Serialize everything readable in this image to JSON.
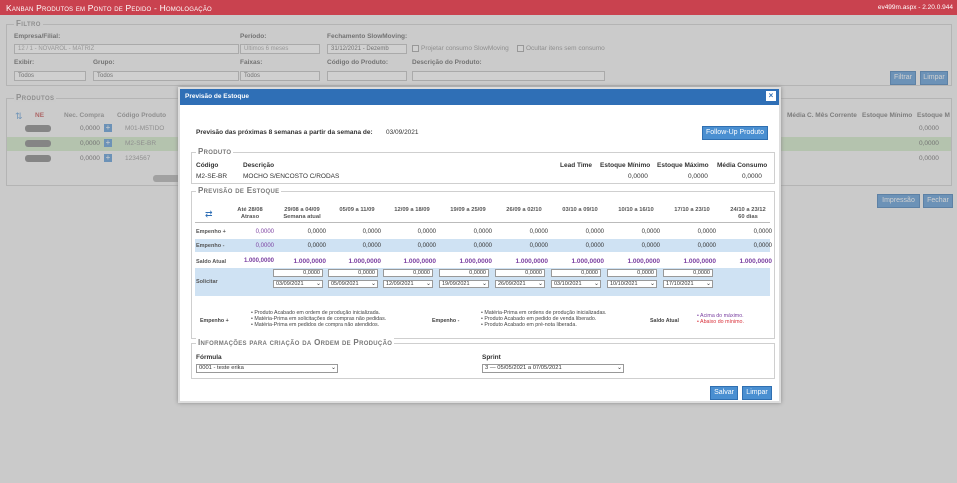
{
  "app": {
    "title": "Kanban Produtos em Ponto de Pedido - Homologação",
    "version": "ev499m.aspx - 2.20.0.944"
  },
  "filter": {
    "legend": "Filtro",
    "empresa_label": "Empresa/Filial:",
    "empresa_value": "12 / 1 - NOVAROL - MATRIZ",
    "periodo_label": "Período:",
    "periodo_value": "Últimos 6 meses",
    "fechamento_label": "Fechamento SlowMoving:",
    "fechamento_value": "31/12/2021 - Dezemb",
    "projetar_label": "Projetar consumo SlowMoving",
    "ocultar_label": "Ocultar itens sem consumo",
    "exibir_label": "Exibir:",
    "exibir_value": "Todos",
    "grupo_label": "Grupo:",
    "grupo_value": "Todos",
    "faixas_label": "Faixas:",
    "faixas_value": "Todos",
    "codigo_label": "Código do Produto:",
    "descricao_label": "Descrição do Produto:",
    "filtrar": "Filtrar",
    "limpar": "Limpar"
  },
  "produtos": {
    "legend": "Produtos",
    "col_ne": "NE",
    "col_nec": "Nec. Compra",
    "col_codigo": "Código Produto",
    "right_cols": [
      "Média",
      "C. Mês Corrente",
      "Estoque Mínimo",
      "Estoque M"
    ],
    "rows": [
      {
        "nec": "0,0000",
        "codigo": "M01-M5TIDO",
        "rval": "0,0000"
      },
      {
        "nec": "0,0000",
        "codigo": "M2-SE-BR",
        "rval": "0,0000"
      },
      {
        "nec": "0,0000",
        "codigo": "1234567",
        "rval": "0,0000"
      }
    ],
    "impressao": "Impressão",
    "fechar": "Fechar"
  },
  "modal": {
    "title": "Previsão de Estoque",
    "close": "×",
    "forecast_label": "Previsão das próximas 8 semanas a partir da semana de:",
    "forecast_date": "03/09/2021",
    "followup": "Follow-Up Produto",
    "produto": {
      "legend": "Produto",
      "h_codigo": "Código",
      "h_descricao": "Descrição",
      "h_lead": "Lead Time",
      "h_min": "Estoque Mínimo",
      "h_max": "Estoque Máximo",
      "h_media": "Média Consumo",
      "codigo": "M2-SE-BR",
      "descricao": "MOCHO S/ENCOSTO C/RODAS",
      "min": "0,0000",
      "max": "0,0000",
      "media": "0,0000"
    },
    "previsao": {
      "legend": "Previsão de Estoque",
      "cols": [
        {
          "l1": "Até 28/08",
          "l2": "Atraso"
        },
        {
          "l1": "29/08 a 04/09",
          "l2": "Semana atual"
        },
        {
          "l1": "05/09 a 11/09",
          "l2": ""
        },
        {
          "l1": "12/09 a 18/09",
          "l2": ""
        },
        {
          "l1": "19/09 a 25/09",
          "l2": ""
        },
        {
          "l1": "26/09 a 02/10",
          "l2": ""
        },
        {
          "l1": "03/10 a 09/10",
          "l2": ""
        },
        {
          "l1": "10/10 a 16/10",
          "l2": ""
        },
        {
          "l1": "17/10 a 23/10",
          "l2": ""
        },
        {
          "l1": "24/10 a 23/12",
          "l2": "60 dias"
        }
      ],
      "row_empenho_plus": "Empenho +",
      "row_empenho_minus": "Empenho -",
      "row_saldo": "Saldo Atual",
      "row_solicitar": "Solicitar",
      "empenho_plus": [
        "0,0000",
        "0,0000",
        "0,0000",
        "0,0000",
        "0,0000",
        "0,0000",
        "0,0000",
        "0,0000",
        "0,0000",
        "0,0000"
      ],
      "empenho_minus": [
        "0,0000",
        "0,0000",
        "0,0000",
        "0,0000",
        "0,0000",
        "0,0000",
        "0,0000",
        "0,0000",
        "0,0000",
        "0,0000"
      ],
      "saldo_first": "1.000,0000",
      "saldo": [
        "1.000,0000",
        "1.000,0000",
        "1.000,0000",
        "1.000,0000",
        "1.000,0000",
        "1.000,0000",
        "1.000,0000",
        "1.000,0000",
        "1.000,0000"
      ],
      "solicitar_qty": [
        "0,0000",
        "0,0000",
        "0,0000",
        "0,0000",
        "0,0000",
        "0,0000",
        "0,0000",
        "0,0000"
      ],
      "solicitar_dates": [
        "03/09/2021",
        "05/09/2021",
        "12/09/2021",
        "19/09/2021",
        "26/09/2021",
        "03/10/2021",
        "10/10/2021",
        "17/10/2021"
      ]
    },
    "legend_block": {
      "plus_title": "Empenho +",
      "plus_items": [
        "Produto Acabado em ordem de produção inicializada.",
        "Matéria-Prima em solicitações de compras não pedidas.",
        "Matéria-Prima em pedidos de compra não atendidos."
      ],
      "minus_title": "Empenho -",
      "minus_items": [
        "Matéria-Prima em ordens de produção inicializadas.",
        "Produto Acabado em pedido de venda liberado.",
        "Produto Acabado em pré-nota liberada."
      ],
      "saldo_title": "Saldo Atual",
      "saldo_items": [
        "Acima do máximo.",
        "Abaixo do mínimo."
      ],
      "colors": {
        "above": "#7a3fa0",
        "below": "#d9323c"
      }
    },
    "ordem": {
      "legend": "Informações para criação da Ordem de Produção",
      "formula_label": "Fórmula",
      "formula_value": "0001 - teste erika",
      "sprint_label": "Sprint",
      "sprint_value": "3 — 05/05/2021 a 07/05/2021"
    },
    "salvar": "Salvar",
    "limpar": "Limpar"
  }
}
